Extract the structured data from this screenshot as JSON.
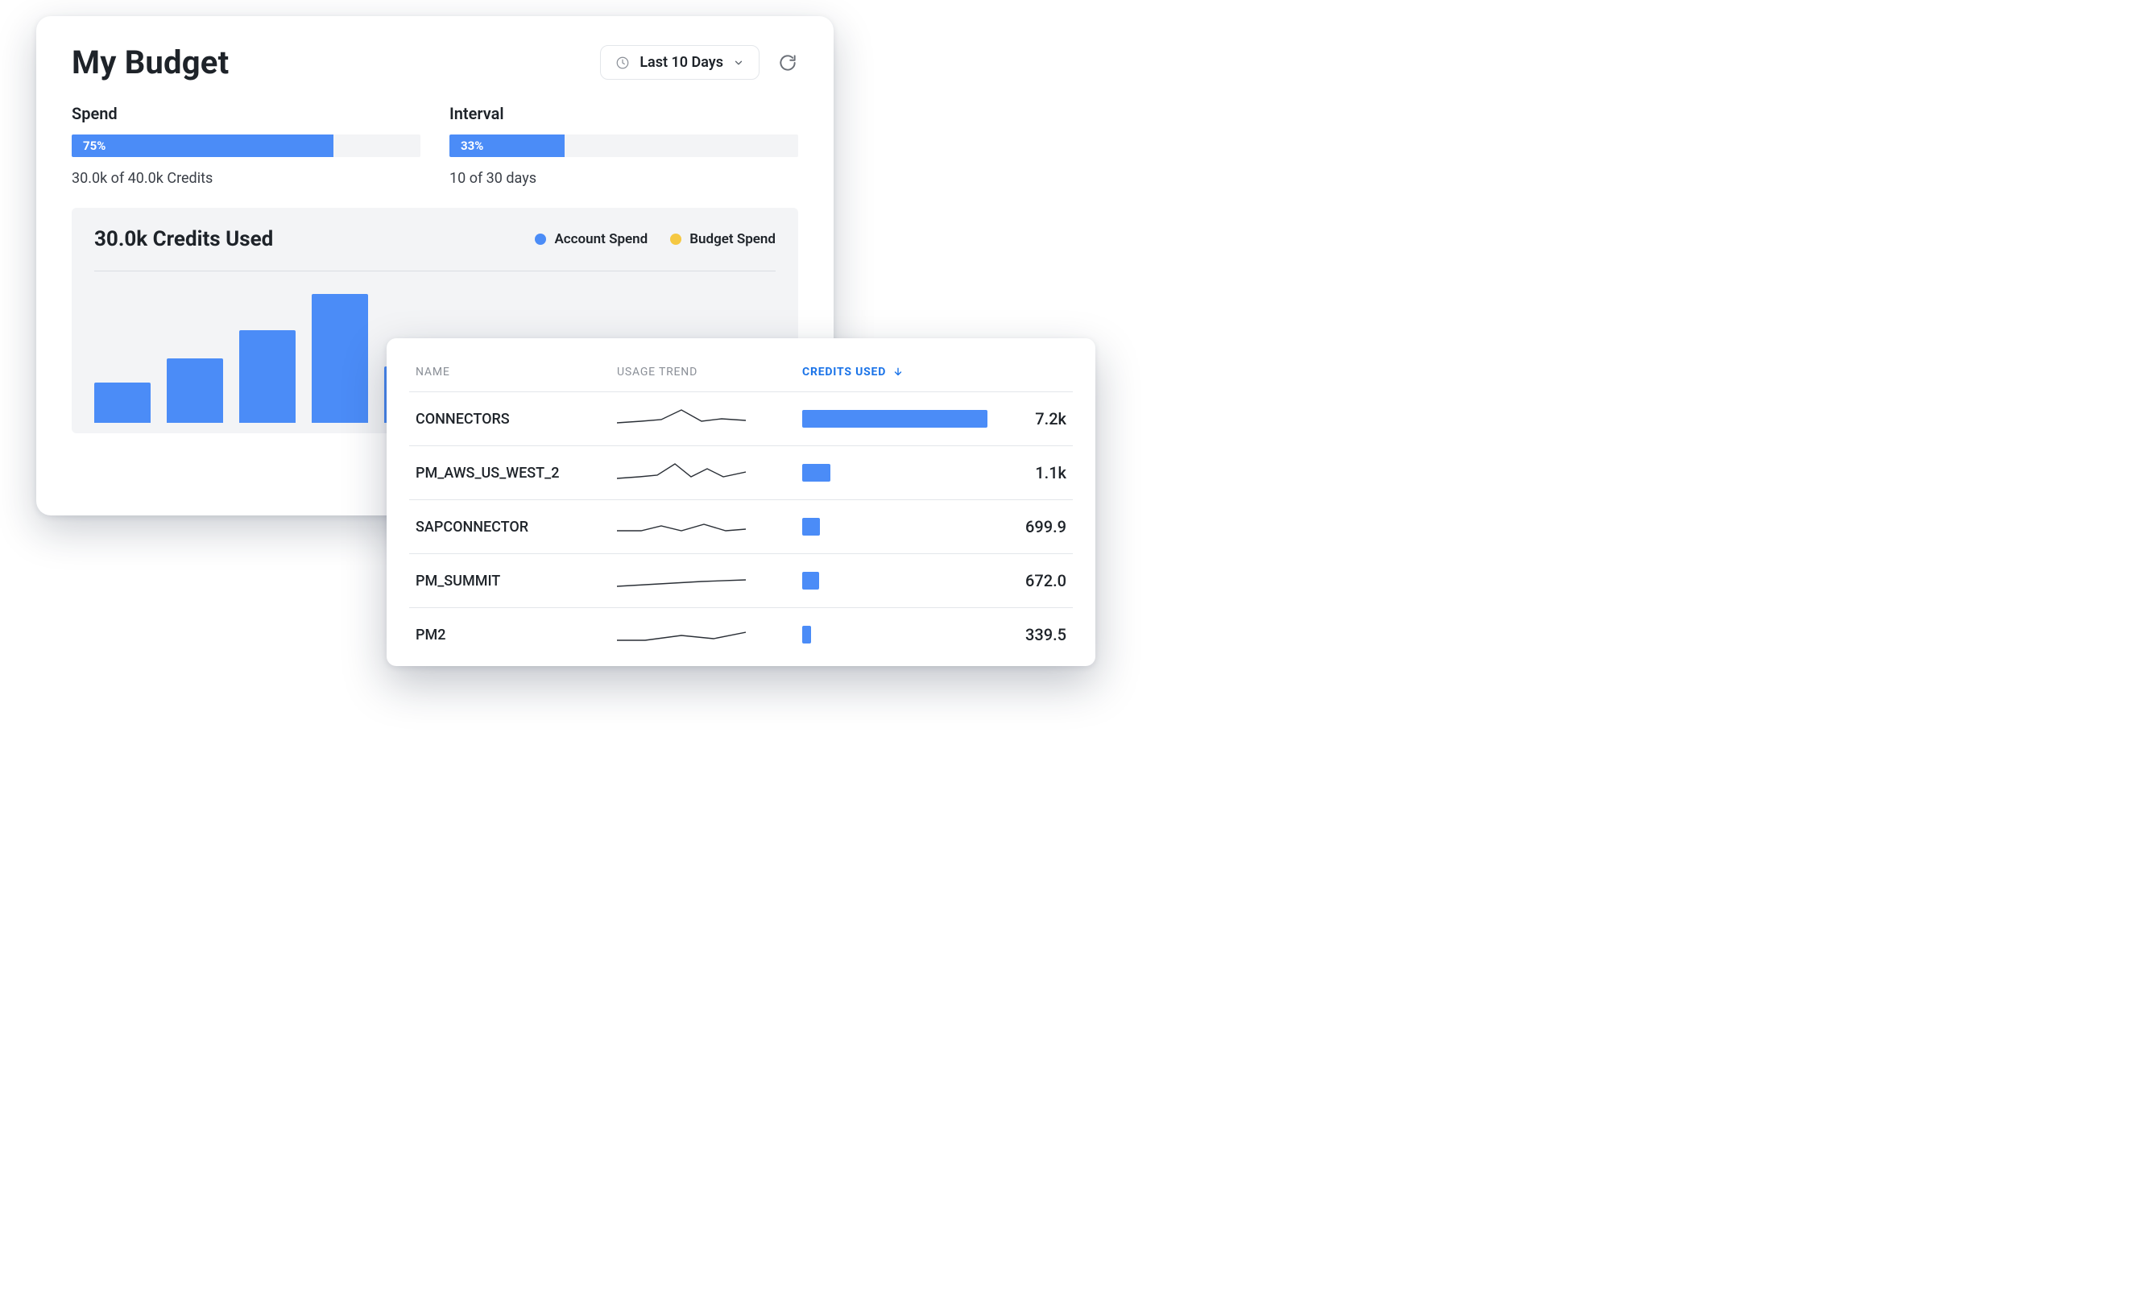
{
  "header": {
    "title": "My Budget",
    "range_label": "Last 10 Days"
  },
  "spend": {
    "label": "Spend",
    "percent": 75,
    "percent_text": "75%",
    "caption": "30.0k of 40.0k Credits"
  },
  "interval": {
    "label": "Interval",
    "percent": 33,
    "percent_text": "33%",
    "caption": "10 of 30 days"
  },
  "credits_chart": {
    "title": "30.0k Credits Used",
    "legend": {
      "account": "Account Spend",
      "budget": "Budget Spend"
    }
  },
  "table": {
    "columns": {
      "name": "NAME",
      "trend": "USAGE TREND",
      "credits": "CREDITS USED"
    },
    "rows": [
      {
        "name": "CONNECTORS",
        "credits_text": "7.2k",
        "credits_value": 7200
      },
      {
        "name": "PM_AWS_US_WEST_2",
        "credits_text": "1.1k",
        "credits_value": 1100
      },
      {
        "name": "SAPCONNECTOR",
        "credits_text": "699.9",
        "credits_value": 699.9
      },
      {
        "name": "PM_SUMMIT",
        "credits_text": "672.0",
        "credits_value": 672.0
      },
      {
        "name": "PM2",
        "credits_text": "339.5",
        "credits_value": 339.5
      }
    ]
  },
  "chart_data": {
    "type": "bar",
    "title": "30.0k Credits Used",
    "series_name": "Account Spend",
    "values": [
      50,
      80,
      115,
      160,
      70
    ],
    "ylim": [
      0,
      170
    ],
    "note": "partial view — fifth bar is clipped by overlay card"
  }
}
